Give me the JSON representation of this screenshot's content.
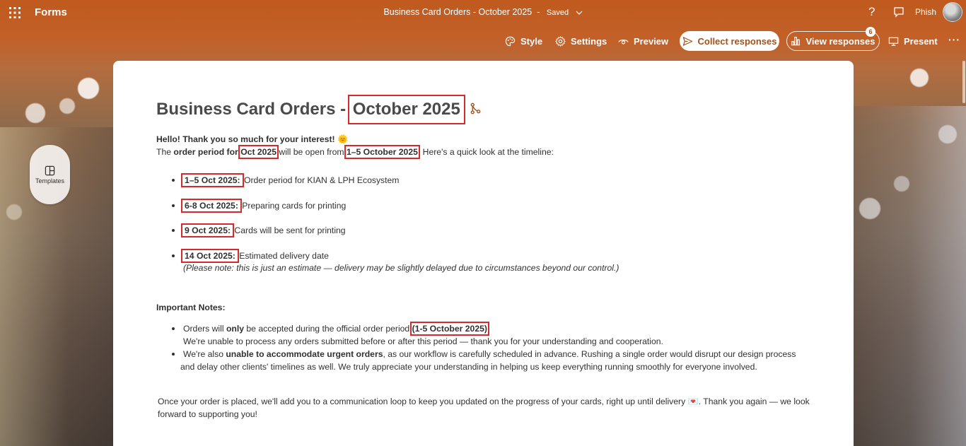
{
  "app": {
    "name": "Forms",
    "doc_title": "Business Card Orders - October 2025",
    "separator": "-",
    "save_status": "Saved",
    "user_name": "Phish"
  },
  "icons": {
    "waffle": "waffle-icon",
    "help": "help-icon",
    "chat": "chat-icon",
    "style": "palette-icon",
    "settings": "gear-icon",
    "preview": "eye-icon",
    "collect": "send-icon",
    "view": "chart-icon",
    "present": "monitor-icon",
    "more": "more-icon",
    "templates": "layout-icon",
    "branching": "branch-icon"
  },
  "toolbar": {
    "style_label": "Style",
    "settings_label": "Settings",
    "preview_label": "Preview",
    "collect_label": "Collect responses",
    "view_label": "View responses",
    "view_badge": "6",
    "present_label": "Present",
    "more_label": "···"
  },
  "side": {
    "templates_label": "Templates"
  },
  "form": {
    "title_prefix": "Business Card Orders -",
    "title_highlight": "October 2025",
    "greeting": "Hello! Thank you so much for your interest! 🌞",
    "intro": {
      "p1": "The ",
      "b1": "order period for",
      "hl1": "Oct 2025",
      "p2": "will be open from ",
      "hl2": "1–5 October 2025",
      "p3": ". Here's a quick look at the timeline:"
    },
    "timeline": [
      {
        "date": "1–5 Oct 2025",
        "sep": ":",
        "text": " Order period for KIAN & LPH Ecosystem"
      },
      {
        "date": "6-8 Oct 2025",
        "sep": ":",
        "text": " Preparing cards for printing"
      },
      {
        "date": "9 Oct 2025",
        "sep": ":",
        "text": " Cards will be sent for printing"
      },
      {
        "date": "14 Oct 2025",
        "sep": ":",
        "text": " Estimated delivery date"
      }
    ],
    "timeline_note": "(Please note: this is just an estimate — delivery may be slightly delayed due to circumstances beyond our control.)",
    "important_title": "Important Notes:",
    "notes": {
      "n1_a": "Orders will ",
      "n1_b": "only",
      "n1_c": " be accepted during the official order period ",
      "n1_hl": "(1-5 October 2025)",
      "n1_line2": "We're unable to process any orders submitted before or after this period — thank you for your understanding and cooperation.",
      "n2_a": "We're also ",
      "n2_b": "unable to accommodate urgent orders",
      "n2_c": ", as our workflow is carefully scheduled in advance. Rushing a single order would disrupt our design process",
      "n2_line2": "and delay other clients' timelines as well. We truly appreciate your understanding in helping us keep everything running smoothly for everyone involved."
    },
    "closing": " Once your order is placed, we'll add you to a communication loop to keep you updated on the progress of your cards, right up until delivery 💌. Thank you again — we look forward to supporting you!"
  },
  "colors": {
    "banner": "#c05a1e",
    "accent": "#a1521c",
    "highlight_box": "#d42a2a"
  }
}
